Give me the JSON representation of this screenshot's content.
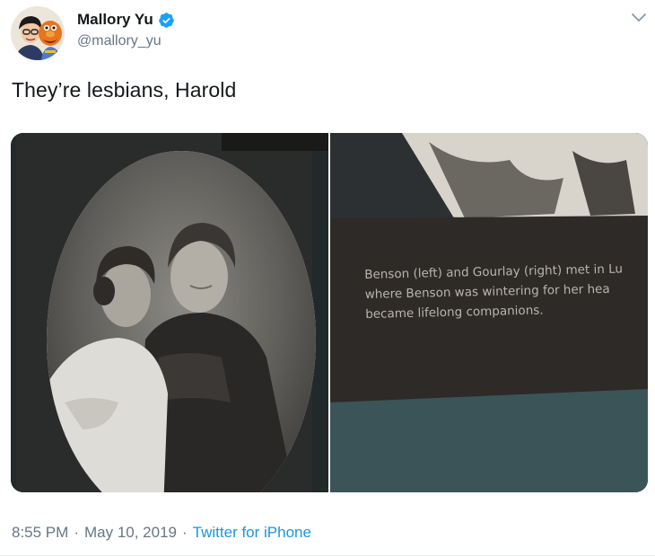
{
  "user": {
    "display_name": "Mallory Yu",
    "handle": "@mallory_yu",
    "verified": true,
    "verified_color": "#1da1f2"
  },
  "icons": {
    "verified": "verified-badge-icon",
    "menu": "chevron-down-icon"
  },
  "tweet": {
    "text": "They’re lesbians, Harold"
  },
  "media": {
    "placard_lines": [
      "Benson (left) and Gourlay (right) met in Lu",
      "where Benson was wintering for her hea",
      "became lifelong companions."
    ]
  },
  "meta": {
    "time": "8:55 PM",
    "sep1": "·",
    "date": "May 10, 2019",
    "sep2": "·",
    "source": "Twitter for iPhone",
    "link_color": "#1b95e0"
  }
}
